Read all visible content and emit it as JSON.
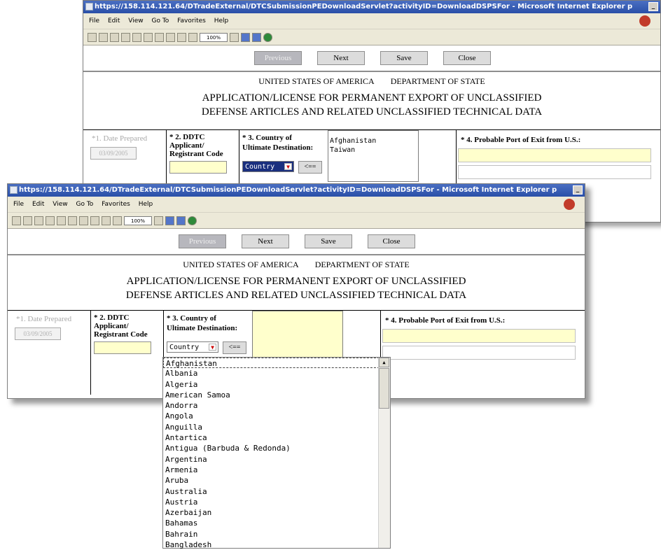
{
  "back_window": {
    "title": "https://158.114.121.64/DTradeExternal/DTCSubmissionPEDownloadServlet?activityID=DownloadDSPSFor - Microsoft Internet Explorer p",
    "menu": [
      "File",
      "Edit",
      "View",
      "Go To",
      "Favorites",
      "Help"
    ],
    "zoom": "100%",
    "buttons": {
      "previous": "Previous",
      "next": "Next",
      "save": "Save",
      "close": "Close"
    },
    "header_line1_a": "UNITED STATES OF AMERICA",
    "header_line1_b": "DEPARTMENT OF STATE",
    "header_line2": "APPLICATION/LICENSE FOR PERMANENT EXPORT OF UNCLASSIFIED",
    "header_line3": "DEFENSE ARTICLES AND RELATED UNCLASSIFIED TECHNICAL DATA",
    "field1_label": "*1. Date Prepared",
    "date_value": "03/09/2005",
    "field2_label_a": "* 2. DDTC",
    "field2_label_b": "Applicant/",
    "field2_label_c": "Registrant Code",
    "field3_label_a": "* 3. Country of",
    "field3_label_b": "Ultimate Destination:",
    "country_select": "Country",
    "add_button": "<==",
    "selected_countries": [
      "Afghanistan",
      "Taiwan"
    ],
    "field4_label": "* 4. Probable Port of Exit from U.S.:"
  },
  "front_window": {
    "title": "https://158.114.121.64/DTradeExternal/DTCSubmissionPEDownloadServlet?activityID=DownloadDSPSFor - Microsoft Internet Explorer p",
    "menu": [
      "File",
      "Edit",
      "View",
      "Go To",
      "Favorites",
      "Help"
    ],
    "zoom": "100%",
    "buttons": {
      "previous": "Previous",
      "next": "Next",
      "save": "Save",
      "close": "Close"
    },
    "header_line1_a": "UNITED STATES OF AMERICA",
    "header_line1_b": "DEPARTMENT OF STATE",
    "header_line2": "APPLICATION/LICENSE FOR PERMANENT EXPORT OF UNCLASSIFIED",
    "header_line3": "DEFENSE ARTICLES AND RELATED UNCLASSIFIED TECHNICAL DATA",
    "field1_label": "*1. Date Prepared",
    "date_value": "03/09/2005",
    "field2_label_a": "* 2. DDTC",
    "field2_label_b": "Applicant/",
    "field2_label_c": "Registrant Code",
    "field3_label_a": "* 3. Country of",
    "field3_label_b": "Ultimate Destination:",
    "country_select": "Country",
    "add_button": "<==",
    "field4_label": "* 4. Probable Port of Exit from U.S.:"
  },
  "country_dropdown": {
    "options": [
      "Afghanistan",
      "Albania",
      "Algeria",
      "American Samoa",
      "Andorra",
      "Angola",
      "Anguilla",
      "Antartica",
      "Antigua (Barbuda & Redonda)",
      "Argentina",
      "Armenia",
      "Aruba",
      "Australia",
      "Austria",
      "Azerbaijan",
      "Bahamas",
      "Bahrain",
      "Bangladesh"
    ]
  },
  "colors": {
    "titlebar": "#2a4fa8",
    "required_field": "#ffffcc",
    "selected_country": "#1a2f7e",
    "disabled_button": "#b7b7bd"
  }
}
